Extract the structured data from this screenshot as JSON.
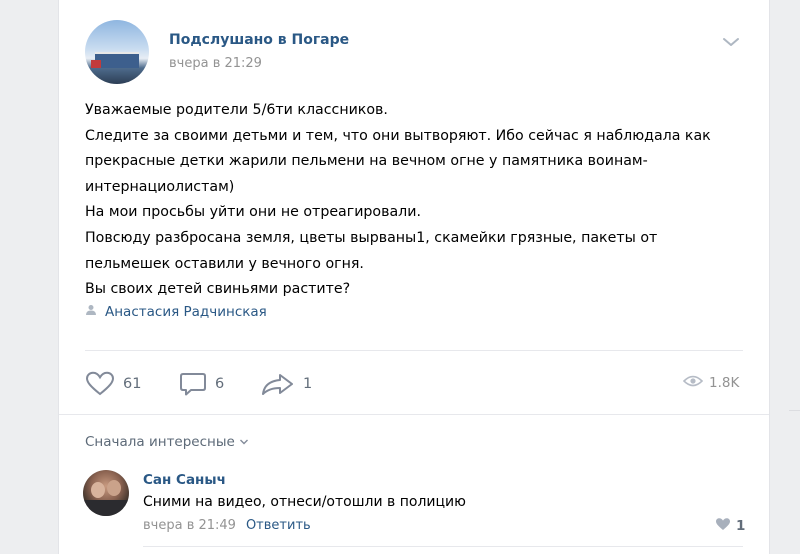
{
  "post": {
    "group_name": "Подслушано в Погаре",
    "time": "вчера в 21:29",
    "lines": [
      "Уважаемые родители 5/6ти классников.",
      "Следите за своими детьми и тем, что они вытворяют. Ибо сейчас я наблюдала как",
      "прекрасные детки жарили пельмени на вечном огне у памятника воинам-",
      "интернациолистам)",
      "На мои просьбы уйти они не отреагировали.",
      "Повсюду разбросана земля, цветы вырваны1, скамейки грязные, пакеты от",
      "пельмешек оставили у вечного огня.",
      "Вы своих детей свиньями растите?"
    ],
    "author": "Анастасия Радчинская"
  },
  "actions": {
    "likes": "61",
    "comments": "6",
    "shares": "1",
    "views": "1.8K"
  },
  "comments": {
    "sort_label": "Сначала интересные",
    "items": [
      {
        "author": "Сан Саныч",
        "text": "Сними на видео, отнеси/отошли в полицию",
        "time": "вчера в 21:49",
        "reply_label": "Ответить",
        "likes": "1"
      }
    ]
  },
  "icons": {
    "menu": "chevron-down-icon",
    "author": "person-icon",
    "like": "heart-icon",
    "comment": "comment-icon",
    "share": "share-icon",
    "views": "eye-icon",
    "comment_like": "heart-icon"
  },
  "colors": {
    "link": "#2a5885",
    "muted": "#939393",
    "background": "#edeef0"
  }
}
